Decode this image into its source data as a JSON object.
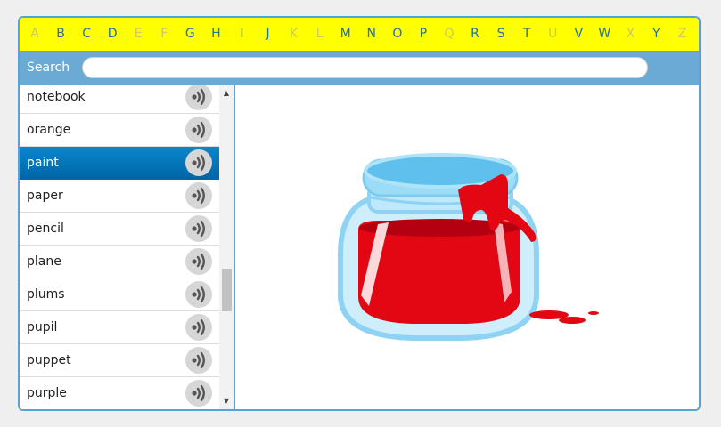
{
  "alphabet": [
    {
      "letter": "A",
      "enabled": false
    },
    {
      "letter": "B",
      "enabled": true
    },
    {
      "letter": "C",
      "enabled": true
    },
    {
      "letter": "D",
      "enabled": true
    },
    {
      "letter": "E",
      "enabled": false
    },
    {
      "letter": "F",
      "enabled": false
    },
    {
      "letter": "G",
      "enabled": true
    },
    {
      "letter": "H",
      "enabled": true
    },
    {
      "letter": "I",
      "enabled": true
    },
    {
      "letter": "J",
      "enabled": true
    },
    {
      "letter": "K",
      "enabled": false
    },
    {
      "letter": "L",
      "enabled": false
    },
    {
      "letter": "M",
      "enabled": true
    },
    {
      "letter": "N",
      "enabled": true
    },
    {
      "letter": "O",
      "enabled": true
    },
    {
      "letter": "P",
      "enabled": true
    },
    {
      "letter": "Q",
      "enabled": false
    },
    {
      "letter": "R",
      "enabled": true
    },
    {
      "letter": "S",
      "enabled": true
    },
    {
      "letter": "T",
      "enabled": true
    },
    {
      "letter": "U",
      "enabled": false
    },
    {
      "letter": "V",
      "enabled": true
    },
    {
      "letter": "W",
      "enabled": true
    },
    {
      "letter": "X",
      "enabled": false
    },
    {
      "letter": "Y",
      "enabled": true
    },
    {
      "letter": "Z",
      "enabled": false
    }
  ],
  "search": {
    "label": "Search",
    "value": "",
    "placeholder": ""
  },
  "word_list": {
    "items": [
      "notebook",
      "orange",
      "paint",
      "paper",
      "pencil",
      "plane",
      "plums",
      "pupil",
      "puppet",
      "purple"
    ],
    "selected": "paint",
    "audio_icon": "speaker-sound-icon"
  },
  "picture": {
    "subject": "paint-jar-icon"
  },
  "colors": {
    "alphabet_bar": "#ffff00",
    "search_bar": "#6aaad5",
    "selected_row": "#0a86cc",
    "frame_border": "#5aa2d6",
    "paint_red": "#e30613",
    "jar_blue": "#8fd3f4"
  }
}
